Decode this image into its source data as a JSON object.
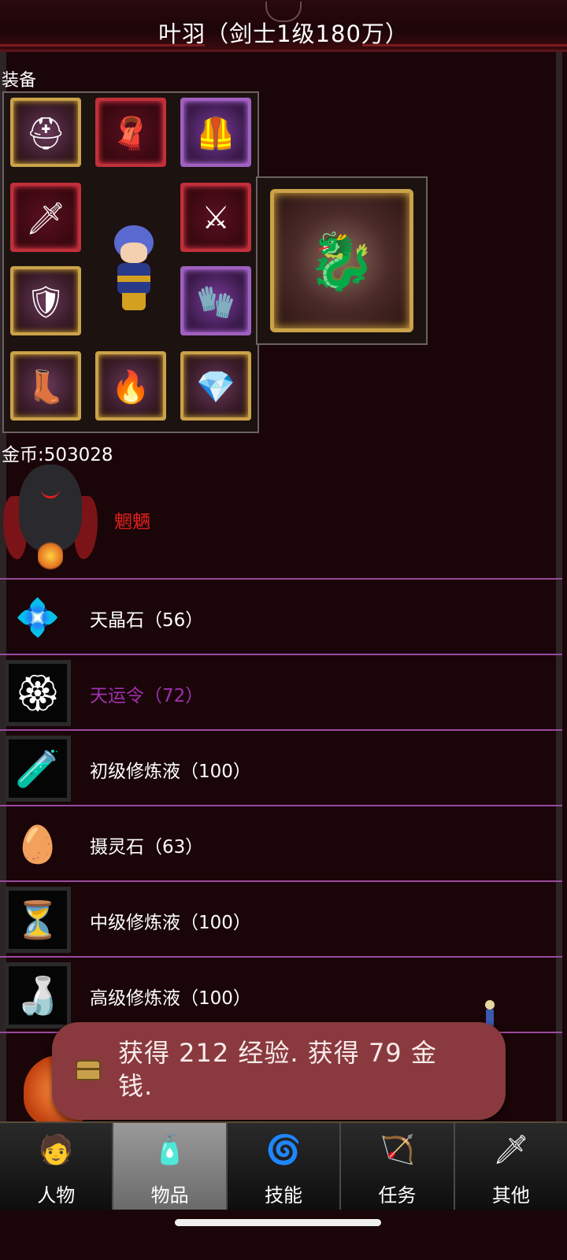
{
  "header": {
    "title": "叶羽（剑士1级180万）"
  },
  "equipment": {
    "section_label": "装备",
    "slots": [
      {
        "name": "helmet-icon",
        "glyph": "⛑"
      },
      {
        "name": "cape-icon",
        "glyph": "🧣"
      },
      {
        "name": "armor-icon",
        "glyph": "🦺"
      },
      {
        "name": "sword-icon",
        "glyph": "🗡"
      },
      {
        "name": "golden-sword-icon",
        "glyph": "⚔"
      },
      {
        "name": "shield-icon",
        "glyph": "🛡"
      },
      {
        "name": "gauntlet-icon",
        "glyph": "🧤"
      },
      {
        "name": "boots-icon",
        "glyph": "👢"
      },
      {
        "name": "flame-armor-icon",
        "glyph": "🔥"
      },
      {
        "name": "ruby-amulet-icon",
        "glyph": "💎"
      }
    ],
    "mount_icon": "beast-mount-icon"
  },
  "gold": {
    "text": "金币:503028"
  },
  "pet": {
    "name": "魍魉"
  },
  "items": [
    {
      "label": "天晶石（56）",
      "icon": "crystal-icon",
      "glyph": "💠",
      "color": "#ffffff"
    },
    {
      "label": "天运令（72）",
      "icon": "fortune-token-icon",
      "glyph": "🏵",
      "color": "#a030b0"
    },
    {
      "label": "初级修炼液（100）",
      "icon": "vial-icon",
      "glyph": "🧪",
      "color": "#ffffff"
    },
    {
      "label": "摄灵石（63）",
      "icon": "spirit-egg-icon",
      "glyph": "🥚",
      "color": "#ffffff"
    },
    {
      "label": "中级修炼液（100）",
      "icon": "hourglass-flask-icon",
      "glyph": "⏳",
      "color": "#ffffff"
    },
    {
      "label": "高级修炼液（100）",
      "icon": "winged-flask-icon",
      "glyph": "🍶",
      "color": "#ffffff"
    }
  ],
  "toast": {
    "text": "获得 212 经验. 获得 79 金钱."
  },
  "tabs": [
    {
      "label": "人物",
      "icon": "character-icon",
      "glyph": "🧑"
    },
    {
      "label": "物品",
      "icon": "potion-icon",
      "glyph": "🧴"
    },
    {
      "label": "技能",
      "icon": "skill-orb-icon",
      "glyph": "🌀"
    },
    {
      "label": "任务",
      "icon": "quest-icon",
      "glyph": "🏹"
    },
    {
      "label": "其他",
      "icon": "other-icon",
      "glyph": "🗡"
    }
  ],
  "active_tab": "物品"
}
